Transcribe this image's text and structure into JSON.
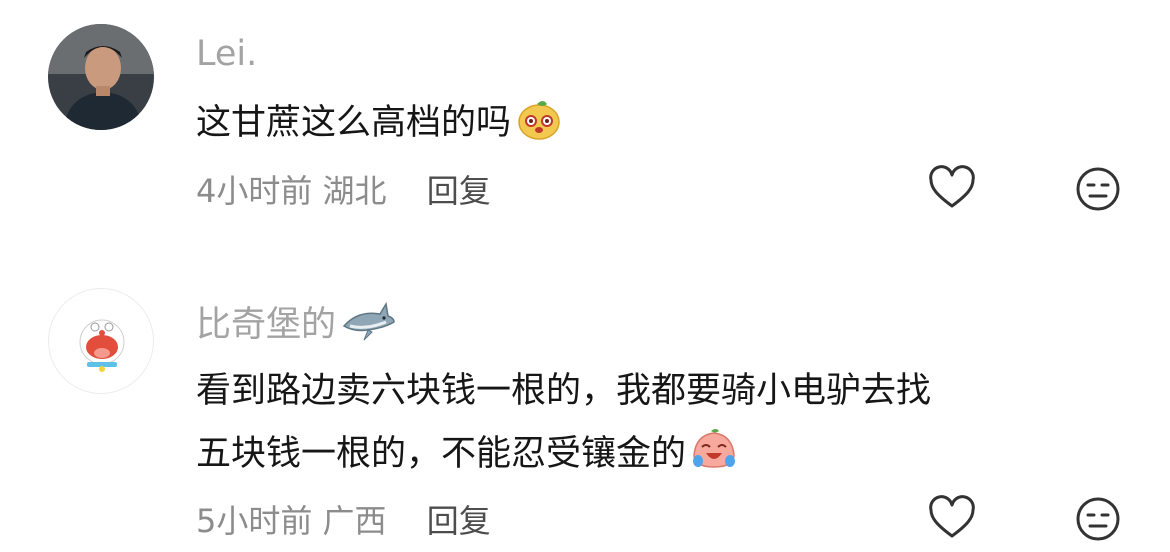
{
  "comments": [
    {
      "username": "Lei.",
      "avatar": "male-portrait-avatar",
      "lines": [
        "这甘蔗这么高档的吗"
      ],
      "inline_emoji": "cute-bun-emoji",
      "time": "4小时前",
      "location": "湖北",
      "reply_label": "回复",
      "like_icon": "heart-icon",
      "dislike_icon": "neutral-face-icon"
    },
    {
      "username": "比奇堡的",
      "username_emoji": "shark-emoji",
      "avatar": "doraemon-avatar",
      "lines": [
        "看到路边卖六块钱一根的，我都要骑小电驴去找",
        "五块钱一根的，不能忍受镶金的"
      ],
      "inline_emoji": "crying-laugh-emoji",
      "time": "5小时前",
      "location": "广西",
      "reply_label": "回复",
      "like_icon": "heart-icon",
      "dislike_icon": "neutral-face-icon"
    }
  ]
}
